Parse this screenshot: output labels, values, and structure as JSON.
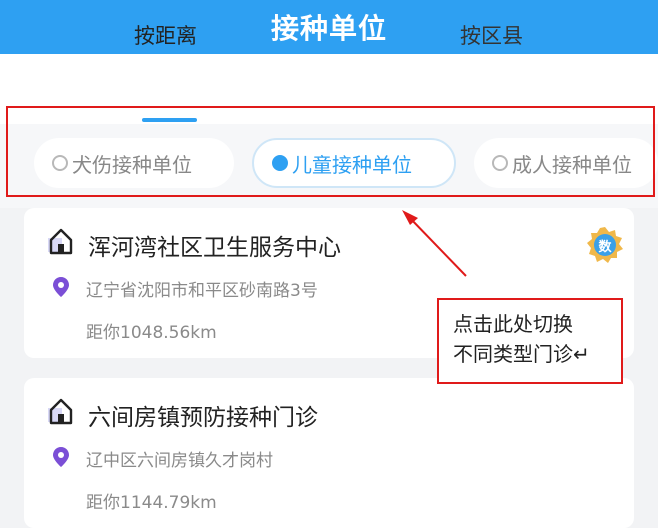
{
  "header": {
    "title": "接种单位"
  },
  "tabs": [
    {
      "label": "按距离",
      "active": true
    },
    {
      "label": "按区县",
      "active": false
    }
  ],
  "filters": [
    {
      "label": "犬伤接种单位",
      "selected": false
    },
    {
      "label": "儿童接种单位",
      "selected": true
    },
    {
      "label": "成人接种单位",
      "selected": false
    }
  ],
  "clinics": [
    {
      "name": "浑河湾社区卫生服务中心",
      "address": "辽宁省沈阳市和平区砂南路3号",
      "distance": "距你1048.56km",
      "badge": "数"
    },
    {
      "name": "六间房镇预防接种门诊",
      "address": "辽中区六间房镇久才岗村",
      "distance": "距你1144.79km"
    }
  ],
  "annotation": {
    "line1": "点击此处切换",
    "line2": "不同类型门诊↵"
  },
  "colors": {
    "accent": "#2ea0f2",
    "highlight": "#e01a1a",
    "pin": "#7b4fd6",
    "badge": "#e9a93a"
  }
}
